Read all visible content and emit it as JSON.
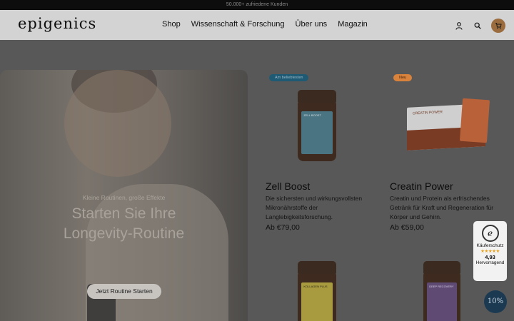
{
  "announcement": "50.000+ zufriedene Kunden",
  "header": {
    "logo": "epigenics",
    "nav": [
      "Shop",
      "Wissenschaft & Forschung",
      "Über uns",
      "Magazin"
    ]
  },
  "hero": {
    "subtitle": "Kleine Routinen, große Effekte",
    "title_line1": "Starten Sie Ihre",
    "title_line2": "Longevity-Routine",
    "button": "Jetzt Routine Starten"
  },
  "products": [
    {
      "badge": "Am beliebtesten",
      "name": "Zell Boost",
      "description": "Die sichersten und wirkungsvollsten Mikronährstoffe der Langlebigkeitsforschung.",
      "price": "Ab €79,00",
      "jar_label": "ZELL BOOST"
    },
    {
      "badge": "Neu",
      "name": "Creatin Power",
      "description": "Creatin und Protein als erfrischendes Getränk für Kraft und Regeneration für Körper und Gehirn.",
      "price": "Ab €59,00",
      "jar_label": "CREATIN POWER"
    },
    {
      "jar_label": "KOLLAGEN PLUS"
    },
    {
      "jar_label": "DEEP RECOVERY"
    }
  ],
  "trust": {
    "title": "Käuferschutz",
    "stars": "★★★★★",
    "score": "4,93",
    "rating": "Hervorragend"
  },
  "discount": "10%",
  "colors": {
    "brand": "#9a6c3e",
    "badge_bestseller": "#1e5a74",
    "badge_new": "#d9823b"
  }
}
